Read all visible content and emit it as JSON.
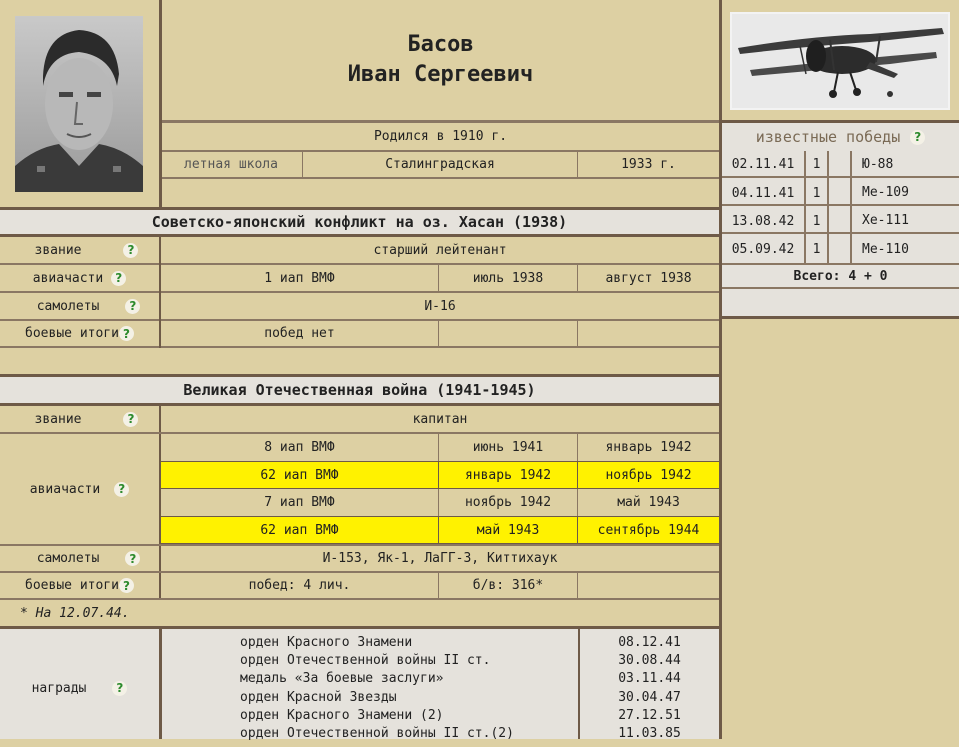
{
  "person": {
    "surname": "Басов",
    "given_names": "Иван Сергеевич",
    "born": "Родился в 1910 г.",
    "school_label": "летная школа",
    "school_name": "Сталинградская",
    "school_year": "1933 г."
  },
  "victories": {
    "title": "известные победы",
    "rows": [
      {
        "date": "02.11.41",
        "count": "1",
        "type": "Ю-88"
      },
      {
        "date": "04.11.41",
        "count": "1",
        "type": "Ме-109"
      },
      {
        "date": "13.08.42",
        "count": "1",
        "type": "Хе-111"
      },
      {
        "date": "05.09.42",
        "count": "1",
        "type": "Ме-110"
      }
    ],
    "total": "Всего: 4 + 0"
  },
  "khasan": {
    "title": "Советско-японский конфликт на оз. Хасан (1938)",
    "rank_label": "звание",
    "rank": "старший лейтенант",
    "units_label": "авиачасти",
    "unit": "1 иап ВМФ",
    "unit_from": "июль 1938",
    "unit_to": "август 1938",
    "planes_label": "самолеты",
    "planes": "И-16",
    "results_label": "боевые итоги",
    "results": "побед нет"
  },
  "ww2": {
    "title": "Великая Отечественная война (1941-1945)",
    "rank_label": "звание",
    "rank": "капитан",
    "units_label": "авиачасти",
    "units": [
      {
        "unit": "8 иап ВМФ",
        "from": "июнь 1941",
        "to": "январь 1942",
        "highlight": false
      },
      {
        "unit": "62 иап ВМФ",
        "from": "январь 1942",
        "to": "ноябрь 1942",
        "highlight": true
      },
      {
        "unit": "7 иап ВМФ",
        "from": "ноябрь 1942",
        "to": "май 1943",
        "highlight": false
      },
      {
        "unit": "62 иап ВМФ",
        "from": "май 1943",
        "to": "сентябрь 1944",
        "highlight": true
      }
    ],
    "planes_label": "самолеты",
    "planes": "И-153, Як-1, ЛаГГ-3, Киттихаук",
    "results_label": "боевые итоги",
    "results_personal": "побед: 4 лич.",
    "results_sorties": "б/в: 316*",
    "footnote": "* На 12.07.44."
  },
  "awards": {
    "label": "награды",
    "items": [
      {
        "name": "орден Красного Знамени",
        "date": "08.12.41"
      },
      {
        "name": "орден Отечественной войны II ст.",
        "date": "30.08.44"
      },
      {
        "name": "медаль «За боевые заслуги»",
        "date": "03.11.44"
      },
      {
        "name": "орден Красной Звезды",
        "date": "30.04.47"
      },
      {
        "name": "орден Красного Знамени (2)",
        "date": "27.12.51"
      },
      {
        "name": "орден Отечественной войны II ст.(2)",
        "date": "11.03.85"
      }
    ]
  },
  "help_glyph": "?"
}
